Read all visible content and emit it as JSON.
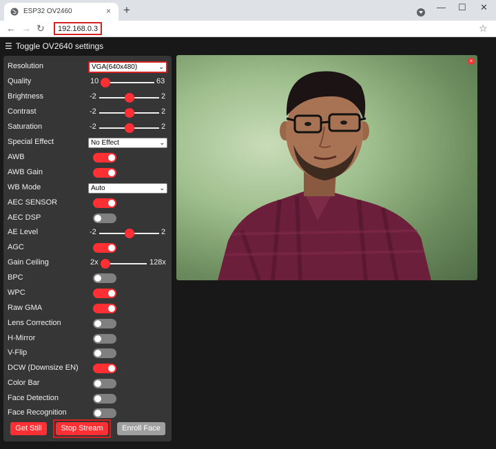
{
  "browser": {
    "tab_title": "ESP32 OV2460",
    "tab_close": "×",
    "new_tab": "+",
    "address": "192.168.0.3",
    "window_min": "—",
    "window_max": "☐",
    "window_close": "✕"
  },
  "header": {
    "toggle_label": "Toggle OV2640 settings",
    "menu_icon": "☰"
  },
  "settings": {
    "resolution": {
      "label": "Resolution",
      "value": "VGA(640x480)"
    },
    "quality": {
      "label": "Quality",
      "min": "10",
      "max": "63",
      "level": 0.08
    },
    "brightness": {
      "label": "Brightness",
      "min": "-2",
      "max": "2",
      "level": 0.5
    },
    "contrast": {
      "label": "Contrast",
      "min": "-2",
      "max": "2",
      "level": 0.5
    },
    "saturation": {
      "label": "Saturation",
      "min": "-2",
      "max": "2",
      "level": 0.5
    },
    "special_effect": {
      "label": "Special Effect",
      "value": "No Effect"
    },
    "awb": {
      "label": "AWB",
      "on": true
    },
    "awb_gain": {
      "label": "AWB Gain",
      "on": true
    },
    "wb_mode": {
      "label": "WB Mode",
      "value": "Auto"
    },
    "aec_sensor": {
      "label": "AEC SENSOR",
      "on": true
    },
    "aec_dsp": {
      "label": "AEC DSP",
      "on": false
    },
    "ae_level": {
      "label": "AE Level",
      "min": "-2",
      "max": "2",
      "level": 0.5
    },
    "agc": {
      "label": "AGC",
      "on": true
    },
    "gain_ceiling": {
      "label": "Gain Ceiling",
      "min": "2x",
      "max": "128x",
      "level": 0.0
    },
    "bpc": {
      "label": "BPC",
      "on": false
    },
    "wpc": {
      "label": "WPC",
      "on": true
    },
    "raw_gma": {
      "label": "Raw GMA",
      "on": true
    },
    "lens_correction": {
      "label": "Lens Correction",
      "on": false
    },
    "h_mirror": {
      "label": "H-Mirror",
      "on": false
    },
    "v_flip": {
      "label": "V-Flip",
      "on": false
    },
    "dcw": {
      "label": "DCW (Downsize EN)",
      "on": true
    },
    "color_bar": {
      "label": "Color Bar",
      "on": false
    },
    "face_detection": {
      "label": "Face Detection",
      "on": false
    },
    "face_recognition": {
      "label": "Face Recognition",
      "on": false
    }
  },
  "buttons": {
    "get_still": "Get Still",
    "stop_stream": "Stop Stream",
    "enroll_face": "Enroll Face"
  },
  "colors": {
    "accent": "#ff3034",
    "panel": "#363636",
    "background": "#181818",
    "switch_off": "#808080"
  }
}
